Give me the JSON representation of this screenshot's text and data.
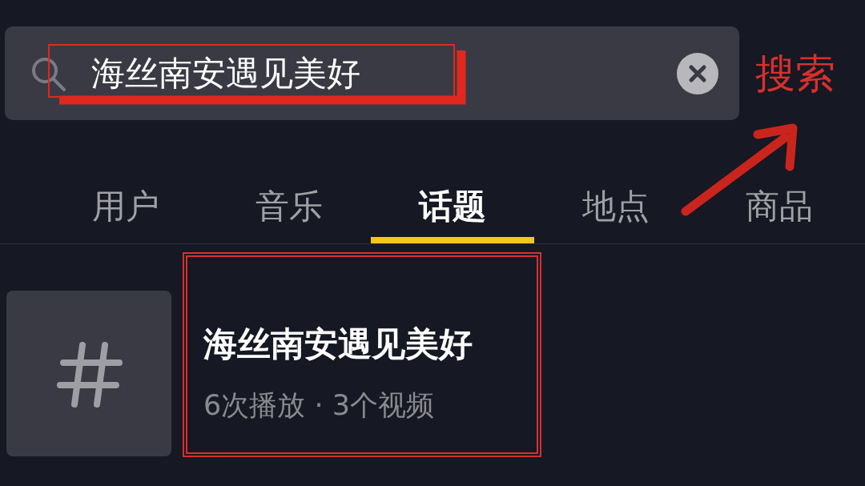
{
  "search": {
    "value": "海丝南安遇见美好"
  },
  "search_button": "搜索",
  "tabs": [
    {
      "label": "用户",
      "selected": false
    },
    {
      "label": "音乐",
      "selected": false
    },
    {
      "label": "话题",
      "selected": true
    },
    {
      "label": "地点",
      "selected": false
    },
    {
      "label": "商品",
      "selected": false
    }
  ],
  "results": [
    {
      "title": "海丝南安遇见美好",
      "stats": "6次播放 · 3个视频"
    }
  ]
}
